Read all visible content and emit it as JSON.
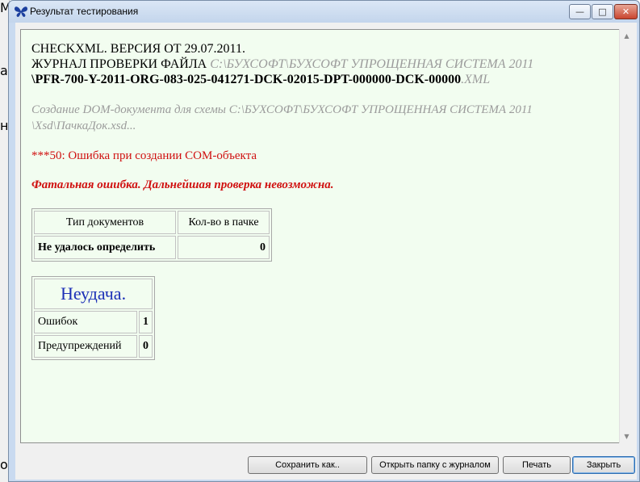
{
  "window": {
    "title": "Результат тестирования",
    "controls": {
      "minimize": "—",
      "maximize": "□",
      "close": "✕"
    }
  },
  "report": {
    "line1": "CHECKXML. ВЕРСИЯ ОТ 29.07.2011.",
    "line2_prefix": "ЖУРНАЛ ПРОВЕРКИ ФАЙЛА ",
    "line2_path": "C:\\БУХСОФТ\\БУХСОФТ УПРОЩЕННАЯ СИСТЕМА 2011",
    "line3_file": "\\PFR-700-Y-2011-ORG-083-025-041271-DCK-02015-DPT-000000-DCK-00000",
    "line3_ext": ".XML",
    "schema_note": "Создание DOM-документа для схемы C:\\БУХСОФТ\\БУХСОФТ УПРОЩЕННАЯ СИСТЕМА 2011 \\Xsd\\ПачкаДок.xsd...",
    "error": "***50: Ошибка при создании COM-объекта",
    "fatal": "Фатальная ошибка. Дальнейшая проверка невозможна.",
    "doc_table": {
      "headers": [
        "Тип документов",
        "Кол-во в пачке"
      ],
      "row": [
        "Не удалось определить",
        "0"
      ]
    },
    "result": {
      "status": "Неудача.",
      "rows": [
        {
          "label": "Ошибок",
          "value": "1"
        },
        {
          "label": "Предупреждений",
          "value": "0"
        }
      ]
    }
  },
  "buttons": {
    "save": "Сохранить как..",
    "open_folder": "Открыть папку с журналом",
    "print": "Печать",
    "close": "Закрыть"
  },
  "colors": {
    "report_background": "#f2fdf0",
    "error_red": "#d01010",
    "status_blue": "#1d30b7",
    "path_gray": "#9b9b9b"
  },
  "icons": {
    "app": "butterfly-icon",
    "scroll_up": "arrow-up-icon",
    "scroll_down": "arrow-down-icon"
  }
}
